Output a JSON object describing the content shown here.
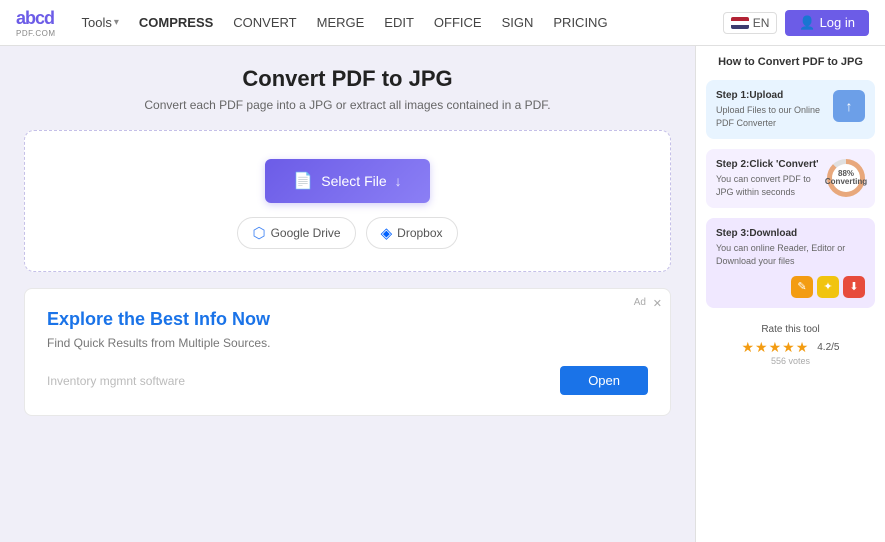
{
  "navbar": {
    "logo_abcd": "abcd",
    "logo_pdf": "PDF.COM",
    "tools_label": "Tools",
    "compress_label": "COMPRESS",
    "convert_label": "CONVERT",
    "merge_label": "MERGE",
    "edit_label": "EDIT",
    "office_label": "OFFICE",
    "sign_label": "SIGN",
    "pricing_label": "PRICING",
    "lang_label": "EN",
    "login_label": "Log in"
  },
  "main": {
    "title": "Convert PDF to JPG",
    "subtitle": "Convert each PDF page into a JPG or extract all images contained in a PDF.",
    "select_file_label": "Select File",
    "google_drive_label": "Google Drive",
    "dropbox_label": "Dropbox"
  },
  "ad": {
    "ad_label": "Ad",
    "title": "Explore the Best Info Now",
    "subtitle": "Find Quick Results from Multiple Sources.",
    "query": "Inventory mgmnt software",
    "open_label": "Open"
  },
  "sidebar": {
    "title": "How to Convert PDF to JPG",
    "step1": {
      "label": "Step 1:Upload",
      "desc": "Upload Files to our Online PDF Converter",
      "icon": "↑"
    },
    "step2": {
      "label": "Step 2:Click 'Convert'",
      "desc": "You can convert PDF to JPG within seconds",
      "progress_label": "88%",
      "progress_sub": "Converting"
    },
    "step3": {
      "label": "Step 3:Download",
      "desc": "You can online Reader, Editor or Download your files"
    },
    "rating": {
      "label": "Rate this tool",
      "stars": "★★★★★",
      "score": "4.2/5",
      "votes": "556 votes"
    }
  }
}
